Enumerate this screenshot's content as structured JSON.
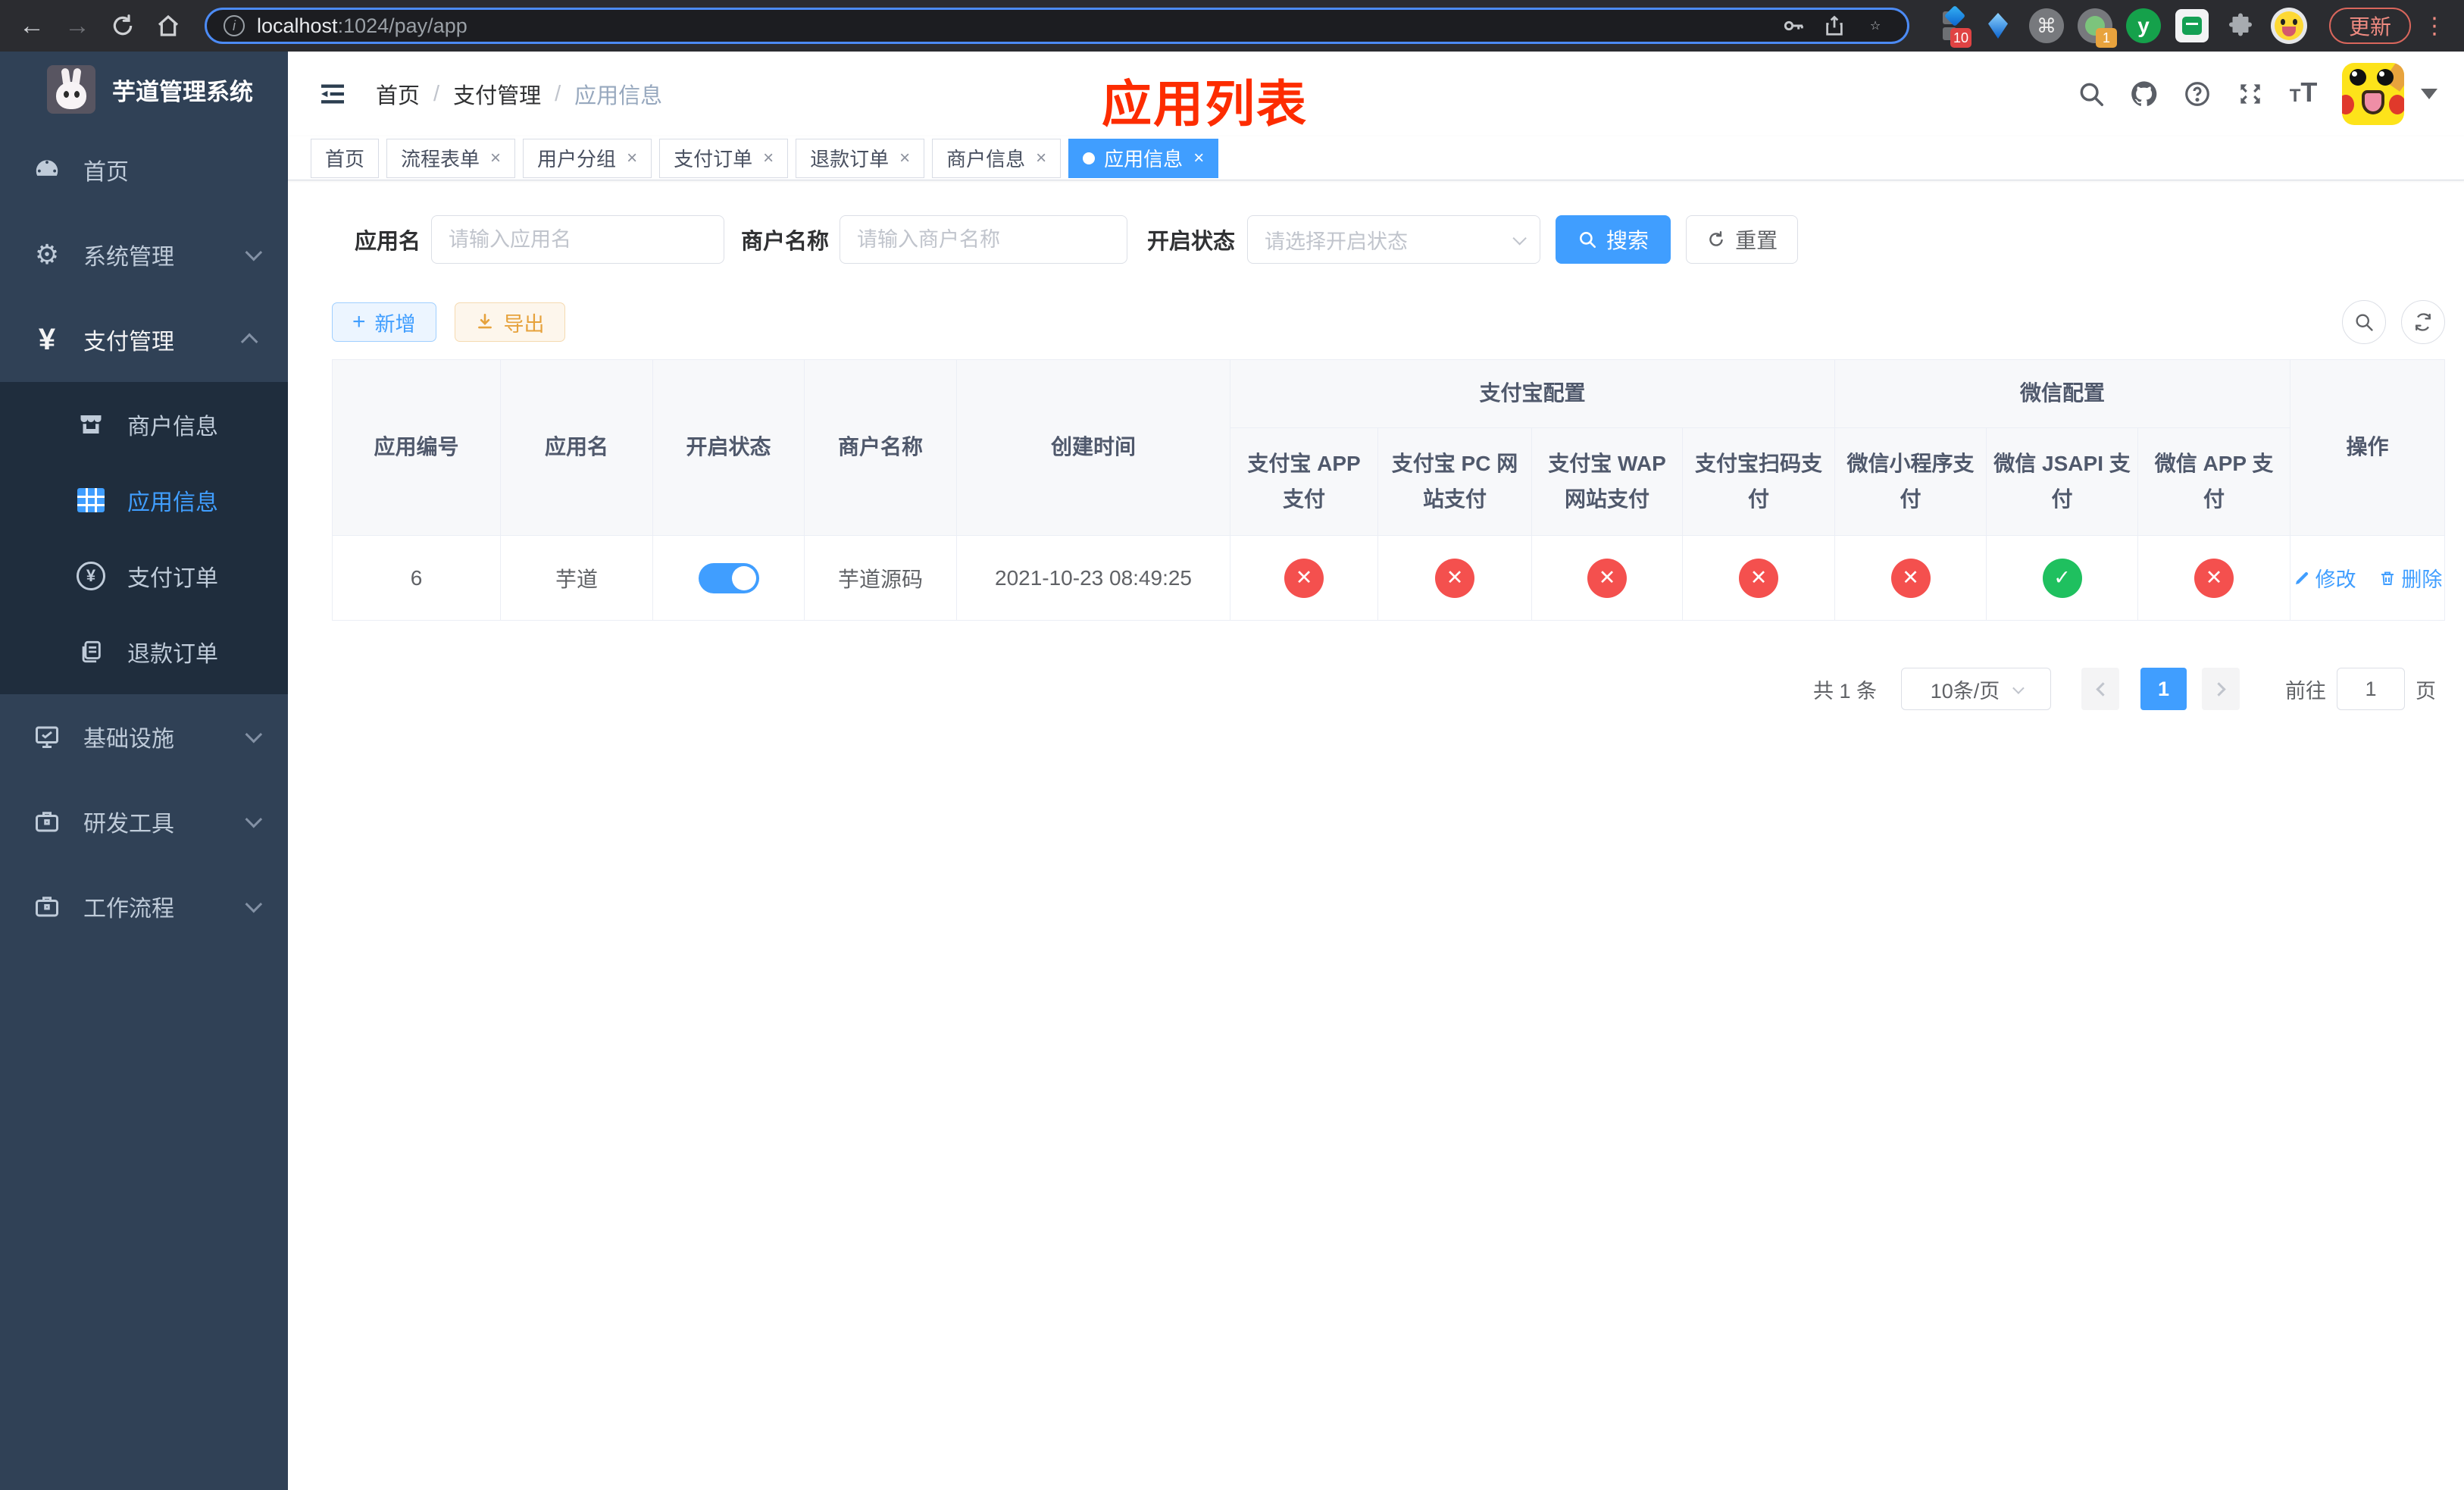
{
  "browser": {
    "url_host": "localhost",
    "url_rest": ":1024/pay/app",
    "ext_badge_blocks": "10",
    "ext_badge_profile": "1",
    "ext_y_label": "y",
    "update_button": "更新"
  },
  "sidebar": {
    "title": "芋道管理系统",
    "items": [
      {
        "label": "首页"
      },
      {
        "label": "系统管理"
      },
      {
        "label": "支付管理"
      },
      {
        "label": "商户信息"
      },
      {
        "label": "应用信息"
      },
      {
        "label": "支付订单"
      },
      {
        "label": "退款订单"
      },
      {
        "label": "基础设施"
      },
      {
        "label": "研发工具"
      },
      {
        "label": "工作流程"
      }
    ]
  },
  "header": {
    "breadcrumb": [
      "首页",
      "支付管理",
      "应用信息"
    ],
    "annotation": "应用列表",
    "annotation_color": "#fd2c00"
  },
  "tabs": [
    {
      "label": "首页"
    },
    {
      "label": "流程表单"
    },
    {
      "label": "用户分组"
    },
    {
      "label": "支付订单"
    },
    {
      "label": "退款订单"
    },
    {
      "label": "商户信息"
    },
    {
      "label": "应用信息"
    }
  ],
  "search": {
    "app_name_label": "应用名",
    "app_name_placeholder": "请输入应用名",
    "merchant_label": "商户名称",
    "merchant_placeholder": "请输入商户名称",
    "status_label": "开启状态",
    "status_placeholder": "请选择开启状态",
    "search_button": "搜索",
    "reset_button": "重置"
  },
  "toolbar": {
    "add_button": "新增",
    "export_button": "导出"
  },
  "table": {
    "columns": [
      "应用编号",
      "应用名",
      "开启状态",
      "商户名称",
      "创建时间"
    ],
    "groups": [
      {
        "label": "支付宝配置",
        "children": [
          "支付宝 APP 支付",
          "支付宝 PC 网站支付",
          "支付宝 WAP 网站支付",
          "支付宝扫码支付"
        ]
      },
      {
        "label": "微信配置",
        "children": [
          "微信小程序支付",
          "微信 JSAPI 支付",
          "微信 APP 支付"
        ]
      }
    ],
    "ops_column": "操作",
    "rows": [
      {
        "id": "6",
        "name": "芋道",
        "enabled": true,
        "merchant": "芋道源码",
        "created": "2021-10-23 08:49:25",
        "payment_status": [
          false,
          false,
          false,
          false,
          false,
          true,
          false
        ],
        "op_edit": "修改",
        "op_delete": "删除"
      }
    ]
  },
  "pagination": {
    "total": "共 1 条",
    "page_size": "10条/页",
    "current_page": "1",
    "goto_label": "前往",
    "goto_value": "1",
    "page_unit": "页"
  },
  "colors": {
    "accent": "#409eff",
    "success": "#1fc05f",
    "danger": "#f4504e"
  }
}
